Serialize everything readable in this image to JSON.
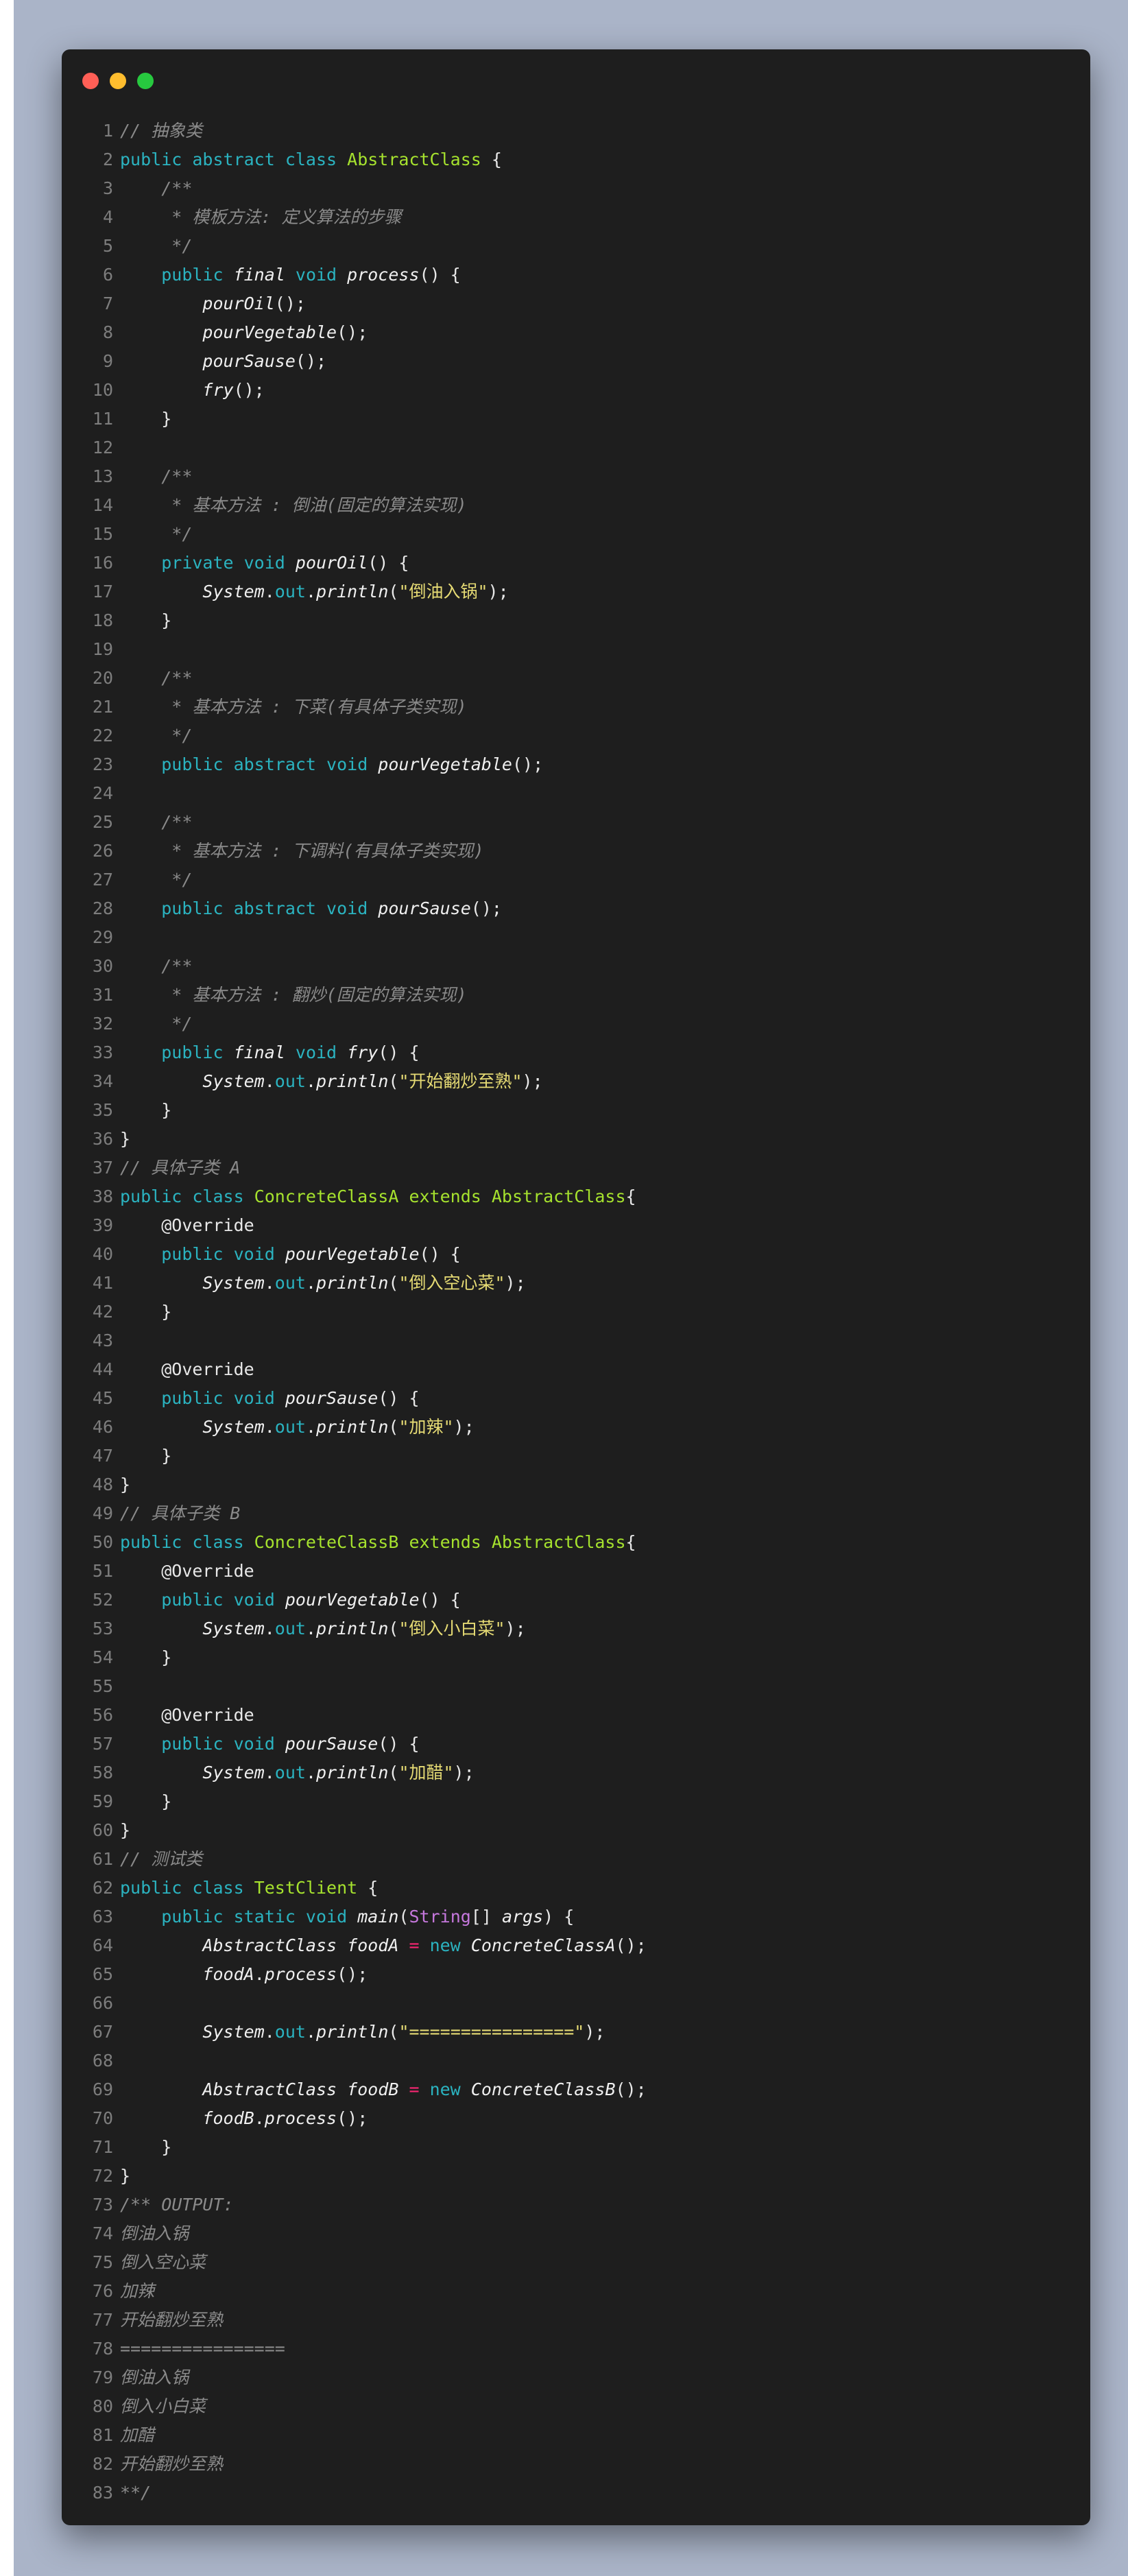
{
  "window": {
    "title_dots": [
      "close",
      "minimize",
      "maximize"
    ],
    "colors": {
      "red": "#ff5f56",
      "yellow": "#ffbd2e",
      "green": "#27c93f",
      "background": "#1e1e1e"
    }
  },
  "lines": [
    {
      "n": "1",
      "indent": "",
      "tokens": [
        {
          "t": "// 抽象类",
          "c": "cm"
        }
      ]
    },
    {
      "n": "2",
      "indent": "",
      "tokens": [
        {
          "t": "public abstract class ",
          "c": "kw"
        },
        {
          "t": "AbstractClass",
          "c": "cls"
        },
        {
          "t": " {",
          "c": "txt"
        }
      ]
    },
    {
      "n": "3",
      "indent": "    ",
      "tokens": [
        {
          "t": "/**",
          "c": "cm"
        }
      ]
    },
    {
      "n": "4",
      "indent": "     ",
      "tokens": [
        {
          "t": "* 模板方法: 定义算法的步骤",
          "c": "cm"
        }
      ]
    },
    {
      "n": "5",
      "indent": "     ",
      "tokens": [
        {
          "t": "*/",
          "c": "cm"
        }
      ]
    },
    {
      "n": "6",
      "indent": "    ",
      "tokens": [
        {
          "t": "public ",
          "c": "kw"
        },
        {
          "t": "final",
          "c": "it"
        },
        {
          "t": " void ",
          "c": "kw"
        },
        {
          "t": "process",
          "c": "it"
        },
        {
          "t": "() {",
          "c": "txt"
        }
      ]
    },
    {
      "n": "7",
      "indent": "        ",
      "tokens": [
        {
          "t": "pourOil",
          "c": "it"
        },
        {
          "t": "();",
          "c": "txt"
        }
      ]
    },
    {
      "n": "8",
      "indent": "        ",
      "tokens": [
        {
          "t": "pourVegetable",
          "c": "it"
        },
        {
          "t": "();",
          "c": "txt"
        }
      ]
    },
    {
      "n": "9",
      "indent": "        ",
      "tokens": [
        {
          "t": "pourSause",
          "c": "it"
        },
        {
          "t": "();",
          "c": "txt"
        }
      ]
    },
    {
      "n": "10",
      "indent": "        ",
      "tokens": [
        {
          "t": "fry",
          "c": "it"
        },
        {
          "t": "();",
          "c": "txt"
        }
      ]
    },
    {
      "n": "11",
      "indent": "    ",
      "tokens": [
        {
          "t": "}",
          "c": "txt"
        }
      ]
    },
    {
      "n": "12",
      "indent": "",
      "tokens": []
    },
    {
      "n": "13",
      "indent": "    ",
      "tokens": [
        {
          "t": "/**",
          "c": "cm"
        }
      ]
    },
    {
      "n": "14",
      "indent": "     ",
      "tokens": [
        {
          "t": "* 基本方法 : 倒油(固定的算法实现)",
          "c": "cm"
        }
      ]
    },
    {
      "n": "15",
      "indent": "     ",
      "tokens": [
        {
          "t": "*/",
          "c": "cm"
        }
      ]
    },
    {
      "n": "16",
      "indent": "    ",
      "tokens": [
        {
          "t": "private void ",
          "c": "kw"
        },
        {
          "t": "pourOil",
          "c": "it"
        },
        {
          "t": "() {",
          "c": "txt"
        }
      ]
    },
    {
      "n": "17",
      "indent": "        ",
      "tokens": [
        {
          "t": "System",
          "c": "it"
        },
        {
          "t": ".",
          "c": "txt"
        },
        {
          "t": "out",
          "c": "fld"
        },
        {
          "t": ".",
          "c": "txt"
        },
        {
          "t": "println",
          "c": "it"
        },
        {
          "t": "(",
          "c": "txt"
        },
        {
          "t": "\"倒油入锅\"",
          "c": "str"
        },
        {
          "t": ");",
          "c": "txt"
        }
      ]
    },
    {
      "n": "18",
      "indent": "    ",
      "tokens": [
        {
          "t": "}",
          "c": "txt"
        }
      ]
    },
    {
      "n": "19",
      "indent": "",
      "tokens": []
    },
    {
      "n": "20",
      "indent": "    ",
      "tokens": [
        {
          "t": "/**",
          "c": "cm"
        }
      ]
    },
    {
      "n": "21",
      "indent": "     ",
      "tokens": [
        {
          "t": "* 基本方法 : 下菜(有具体子类实现)",
          "c": "cm"
        }
      ]
    },
    {
      "n": "22",
      "indent": "     ",
      "tokens": [
        {
          "t": "*/",
          "c": "cm"
        }
      ]
    },
    {
      "n": "23",
      "indent": "    ",
      "tokens": [
        {
          "t": "public abstract void ",
          "c": "kw"
        },
        {
          "t": "pourVegetable",
          "c": "it"
        },
        {
          "t": "();",
          "c": "txt"
        }
      ]
    },
    {
      "n": "24",
      "indent": "",
      "tokens": []
    },
    {
      "n": "25",
      "indent": "    ",
      "tokens": [
        {
          "t": "/**",
          "c": "cm"
        }
      ]
    },
    {
      "n": "26",
      "indent": "     ",
      "tokens": [
        {
          "t": "* 基本方法 : 下调料(有具体子类实现)",
          "c": "cm"
        }
      ]
    },
    {
      "n": "27",
      "indent": "     ",
      "tokens": [
        {
          "t": "*/",
          "c": "cm"
        }
      ]
    },
    {
      "n": "28",
      "indent": "    ",
      "tokens": [
        {
          "t": "public abstract void ",
          "c": "kw"
        },
        {
          "t": "pourSause",
          "c": "it"
        },
        {
          "t": "();",
          "c": "txt"
        }
      ]
    },
    {
      "n": "29",
      "indent": "",
      "tokens": []
    },
    {
      "n": "30",
      "indent": "    ",
      "tokens": [
        {
          "t": "/**",
          "c": "cm"
        }
      ]
    },
    {
      "n": "31",
      "indent": "     ",
      "tokens": [
        {
          "t": "* 基本方法 : 翻炒(固定的算法实现)",
          "c": "cm"
        }
      ]
    },
    {
      "n": "32",
      "indent": "     ",
      "tokens": [
        {
          "t": "*/",
          "c": "cm"
        }
      ]
    },
    {
      "n": "33",
      "indent": "    ",
      "tokens": [
        {
          "t": "public ",
          "c": "kw"
        },
        {
          "t": "final",
          "c": "it"
        },
        {
          "t": " void ",
          "c": "kw"
        },
        {
          "t": "fry",
          "c": "it"
        },
        {
          "t": "() {",
          "c": "txt"
        }
      ]
    },
    {
      "n": "34",
      "indent": "        ",
      "tokens": [
        {
          "t": "System",
          "c": "it"
        },
        {
          "t": ".",
          "c": "txt"
        },
        {
          "t": "out",
          "c": "fld"
        },
        {
          "t": ".",
          "c": "txt"
        },
        {
          "t": "println",
          "c": "it"
        },
        {
          "t": "(",
          "c": "txt"
        },
        {
          "t": "\"开始翻炒至熟\"",
          "c": "str"
        },
        {
          "t": ");",
          "c": "txt"
        }
      ]
    },
    {
      "n": "35",
      "indent": "    ",
      "tokens": [
        {
          "t": "}",
          "c": "txt"
        }
      ]
    },
    {
      "n": "36",
      "indent": "",
      "tokens": [
        {
          "t": "}",
          "c": "txt"
        }
      ]
    },
    {
      "n": "37",
      "indent": "",
      "tokens": [
        {
          "t": "// 具体子类 A",
          "c": "cm"
        }
      ]
    },
    {
      "n": "38",
      "indent": "",
      "tokens": [
        {
          "t": "public class ",
          "c": "kw"
        },
        {
          "t": "ConcreteClassA",
          "c": "cls"
        },
        {
          "t": " extends ",
          "c": "cls"
        },
        {
          "t": "AbstractClass",
          "c": "cls"
        },
        {
          "t": "{",
          "c": "txt"
        }
      ]
    },
    {
      "n": "39",
      "indent": "    ",
      "tokens": [
        {
          "t": "@Override",
          "c": "txt"
        }
      ]
    },
    {
      "n": "40",
      "indent": "    ",
      "tokens": [
        {
          "t": "public void ",
          "c": "kw"
        },
        {
          "t": "pourVegetable",
          "c": "it"
        },
        {
          "t": "() {",
          "c": "txt"
        }
      ]
    },
    {
      "n": "41",
      "indent": "        ",
      "tokens": [
        {
          "t": "System",
          "c": "it"
        },
        {
          "t": ".",
          "c": "txt"
        },
        {
          "t": "out",
          "c": "fld"
        },
        {
          "t": ".",
          "c": "txt"
        },
        {
          "t": "println",
          "c": "it"
        },
        {
          "t": "(",
          "c": "txt"
        },
        {
          "t": "\"倒入空心菜\"",
          "c": "str"
        },
        {
          "t": ");",
          "c": "txt"
        }
      ]
    },
    {
      "n": "42",
      "indent": "    ",
      "tokens": [
        {
          "t": "}",
          "c": "txt"
        }
      ]
    },
    {
      "n": "43",
      "indent": "",
      "tokens": []
    },
    {
      "n": "44",
      "indent": "    ",
      "tokens": [
        {
          "t": "@Override",
          "c": "txt"
        }
      ]
    },
    {
      "n": "45",
      "indent": "    ",
      "tokens": [
        {
          "t": "public void ",
          "c": "kw"
        },
        {
          "t": "pourSause",
          "c": "it"
        },
        {
          "t": "() {",
          "c": "txt"
        }
      ]
    },
    {
      "n": "46",
      "indent": "        ",
      "tokens": [
        {
          "t": "System",
          "c": "it"
        },
        {
          "t": ".",
          "c": "txt"
        },
        {
          "t": "out",
          "c": "fld"
        },
        {
          "t": ".",
          "c": "txt"
        },
        {
          "t": "println",
          "c": "it"
        },
        {
          "t": "(",
          "c": "txt"
        },
        {
          "t": "\"加辣\"",
          "c": "str"
        },
        {
          "t": ");",
          "c": "txt"
        }
      ]
    },
    {
      "n": "47",
      "indent": "    ",
      "tokens": [
        {
          "t": "}",
          "c": "txt"
        }
      ]
    },
    {
      "n": "48",
      "indent": "",
      "tokens": [
        {
          "t": "}",
          "c": "txt"
        }
      ]
    },
    {
      "n": "49",
      "indent": "",
      "tokens": [
        {
          "t": "// 具体子类 B",
          "c": "cm"
        }
      ]
    },
    {
      "n": "50",
      "indent": "",
      "tokens": [
        {
          "t": "public class ",
          "c": "kw"
        },
        {
          "t": "ConcreteClassB",
          "c": "cls"
        },
        {
          "t": " extends ",
          "c": "cls"
        },
        {
          "t": "AbstractClass",
          "c": "cls"
        },
        {
          "t": "{",
          "c": "txt"
        }
      ]
    },
    {
      "n": "51",
      "indent": "    ",
      "tokens": [
        {
          "t": "@Override",
          "c": "txt"
        }
      ]
    },
    {
      "n": "52",
      "indent": "    ",
      "tokens": [
        {
          "t": "public void ",
          "c": "kw"
        },
        {
          "t": "pourVegetable",
          "c": "it"
        },
        {
          "t": "() {",
          "c": "txt"
        }
      ]
    },
    {
      "n": "53",
      "indent": "        ",
      "tokens": [
        {
          "t": "System",
          "c": "it"
        },
        {
          "t": ".",
          "c": "txt"
        },
        {
          "t": "out",
          "c": "fld"
        },
        {
          "t": ".",
          "c": "txt"
        },
        {
          "t": "println",
          "c": "it"
        },
        {
          "t": "(",
          "c": "txt"
        },
        {
          "t": "\"倒入小白菜\"",
          "c": "str"
        },
        {
          "t": ");",
          "c": "txt"
        }
      ]
    },
    {
      "n": "54",
      "indent": "    ",
      "tokens": [
        {
          "t": "}",
          "c": "txt"
        }
      ]
    },
    {
      "n": "55",
      "indent": "",
      "tokens": []
    },
    {
      "n": "56",
      "indent": "    ",
      "tokens": [
        {
          "t": "@Override",
          "c": "txt"
        }
      ]
    },
    {
      "n": "57",
      "indent": "    ",
      "tokens": [
        {
          "t": "public void ",
          "c": "kw"
        },
        {
          "t": "pourSause",
          "c": "it"
        },
        {
          "t": "() {",
          "c": "txt"
        }
      ]
    },
    {
      "n": "58",
      "indent": "        ",
      "tokens": [
        {
          "t": "System",
          "c": "it"
        },
        {
          "t": ".",
          "c": "txt"
        },
        {
          "t": "out",
          "c": "fld"
        },
        {
          "t": ".",
          "c": "txt"
        },
        {
          "t": "println",
          "c": "it"
        },
        {
          "t": "(",
          "c": "txt"
        },
        {
          "t": "\"加醋\"",
          "c": "str"
        },
        {
          "t": ");",
          "c": "txt"
        }
      ]
    },
    {
      "n": "59",
      "indent": "    ",
      "tokens": [
        {
          "t": "}",
          "c": "txt"
        }
      ]
    },
    {
      "n": "60",
      "indent": "",
      "tokens": [
        {
          "t": "}",
          "c": "txt"
        }
      ]
    },
    {
      "n": "61",
      "indent": "",
      "tokens": [
        {
          "t": "// 测试类",
          "c": "cm"
        }
      ]
    },
    {
      "n": "62",
      "indent": "",
      "tokens": [
        {
          "t": "public class ",
          "c": "kw"
        },
        {
          "t": "TestClient",
          "c": "cls"
        },
        {
          "t": " {",
          "c": "txt"
        }
      ]
    },
    {
      "n": "63",
      "indent": "    ",
      "tokens": [
        {
          "t": "public static void ",
          "c": "kw"
        },
        {
          "t": "main",
          "c": "it"
        },
        {
          "t": "(",
          "c": "txt"
        },
        {
          "t": "String",
          "c": "typ"
        },
        {
          "t": "[] ",
          "c": "txt"
        },
        {
          "t": "args",
          "c": "it"
        },
        {
          "t": ") {",
          "c": "txt"
        }
      ]
    },
    {
      "n": "64",
      "indent": "        ",
      "tokens": [
        {
          "t": "AbstractClass",
          "c": "it"
        },
        {
          "t": " ",
          "c": "txt"
        },
        {
          "t": "foodA",
          "c": "it"
        },
        {
          "t": " = ",
          "c": "op"
        },
        {
          "t": "new ",
          "c": "kw"
        },
        {
          "t": "ConcreteClassA",
          "c": "it"
        },
        {
          "t": "();",
          "c": "txt"
        }
      ]
    },
    {
      "n": "65",
      "indent": "        ",
      "tokens": [
        {
          "t": "foodA",
          "c": "it"
        },
        {
          "t": ".",
          "c": "txt"
        },
        {
          "t": "process",
          "c": "it"
        },
        {
          "t": "();",
          "c": "txt"
        }
      ]
    },
    {
      "n": "66",
      "indent": "",
      "tokens": []
    },
    {
      "n": "67",
      "indent": "        ",
      "tokens": [
        {
          "t": "System",
          "c": "it"
        },
        {
          "t": ".",
          "c": "txt"
        },
        {
          "t": "out",
          "c": "fld"
        },
        {
          "t": ".",
          "c": "txt"
        },
        {
          "t": "println",
          "c": "it"
        },
        {
          "t": "(",
          "c": "txt"
        },
        {
          "t": "\"================\"",
          "c": "str"
        },
        {
          "t": ");",
          "c": "txt"
        }
      ]
    },
    {
      "n": "68",
      "indent": "",
      "tokens": []
    },
    {
      "n": "69",
      "indent": "        ",
      "tokens": [
        {
          "t": "AbstractClass",
          "c": "it"
        },
        {
          "t": " ",
          "c": "txt"
        },
        {
          "t": "foodB",
          "c": "it"
        },
        {
          "t": " = ",
          "c": "op"
        },
        {
          "t": "new ",
          "c": "kw"
        },
        {
          "t": "ConcreteClassB",
          "c": "it"
        },
        {
          "t": "();",
          "c": "txt"
        }
      ]
    },
    {
      "n": "70",
      "indent": "        ",
      "tokens": [
        {
          "t": "foodB",
          "c": "it"
        },
        {
          "t": ".",
          "c": "txt"
        },
        {
          "t": "process",
          "c": "it"
        },
        {
          "t": "();",
          "c": "txt"
        }
      ]
    },
    {
      "n": "71",
      "indent": "    ",
      "tokens": [
        {
          "t": "}",
          "c": "txt"
        }
      ]
    },
    {
      "n": "72",
      "indent": "",
      "tokens": [
        {
          "t": "}",
          "c": "txt"
        }
      ]
    },
    {
      "n": "73",
      "indent": "",
      "tokens": [
        {
          "t": "/** OUTPUT:",
          "c": "cm"
        }
      ]
    },
    {
      "n": "74",
      "indent": "",
      "tokens": [
        {
          "t": "倒油入锅",
          "c": "cm"
        }
      ]
    },
    {
      "n": "75",
      "indent": "",
      "tokens": [
        {
          "t": "倒入空心菜",
          "c": "cm"
        }
      ]
    },
    {
      "n": "76",
      "indent": "",
      "tokens": [
        {
          "t": "加辣",
          "c": "cm"
        }
      ]
    },
    {
      "n": "77",
      "indent": "",
      "tokens": [
        {
          "t": "开始翻炒至熟",
          "c": "cm"
        }
      ]
    },
    {
      "n": "78",
      "indent": "",
      "tokens": [
        {
          "t": "================",
          "c": "cm"
        }
      ]
    },
    {
      "n": "79",
      "indent": "",
      "tokens": [
        {
          "t": "倒油入锅",
          "c": "cm"
        }
      ]
    },
    {
      "n": "80",
      "indent": "",
      "tokens": [
        {
          "t": "倒入小白菜",
          "c": "cm"
        }
      ]
    },
    {
      "n": "81",
      "indent": "",
      "tokens": [
        {
          "t": "加醋",
          "c": "cm"
        }
      ]
    },
    {
      "n": "82",
      "indent": "",
      "tokens": [
        {
          "t": "开始翻炒至熟",
          "c": "cm"
        }
      ]
    },
    {
      "n": "83",
      "indent": "",
      "tokens": [
        {
          "t": "**/",
          "c": "cm"
        }
      ]
    }
  ]
}
